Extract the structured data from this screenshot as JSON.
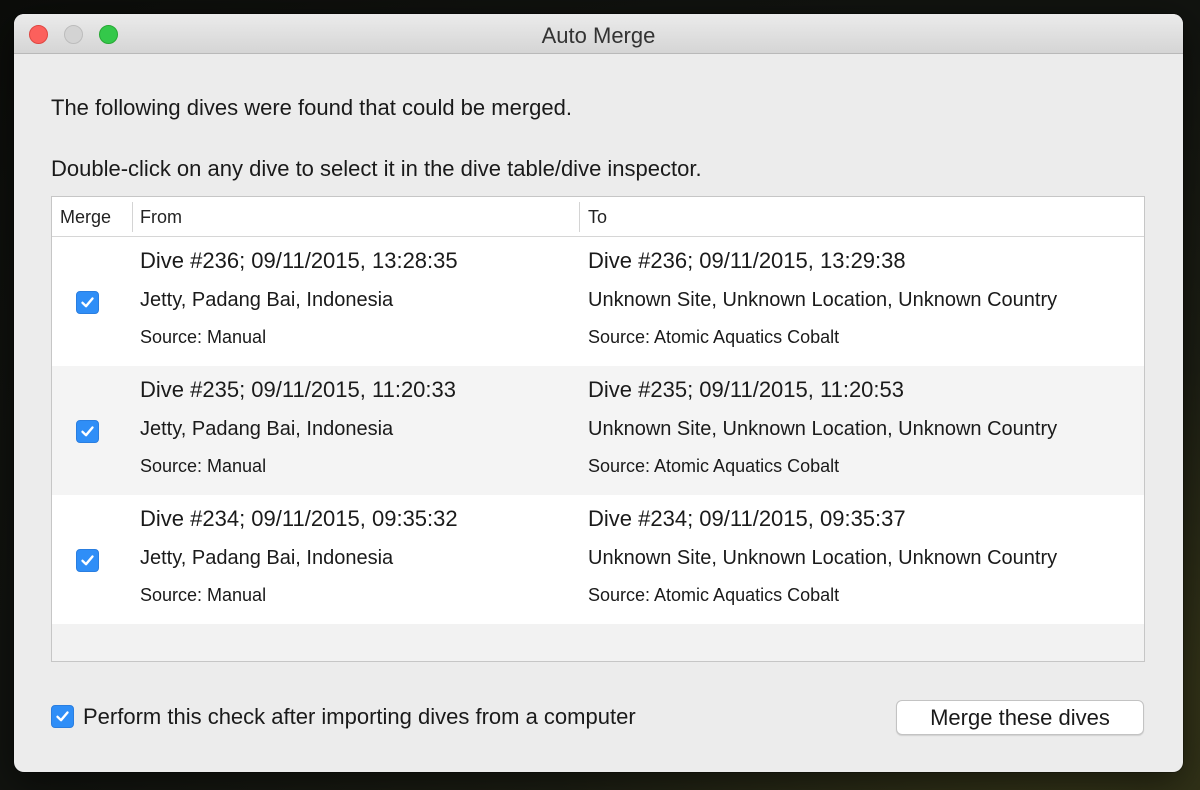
{
  "window": {
    "title": "Auto Merge"
  },
  "intro": {
    "line1": "The following dives were found that could be merged.",
    "line2": "Double-click on any dive to select it in the dive table/dive inspector."
  },
  "table": {
    "headers": {
      "merge": "Merge",
      "from": "From",
      "to": "To"
    },
    "rows": [
      {
        "checked": true,
        "from": {
          "dive": "Dive #236; 09/11/2015, 13:28:35",
          "location": "Jetty, Padang Bai, Indonesia",
          "source": "Source: Manual"
        },
        "to": {
          "dive": "Dive #236; 09/11/2015, 13:29:38",
          "location": "Unknown Site, Unknown Location, Unknown Country",
          "source": "Source: Atomic Aquatics Cobalt"
        }
      },
      {
        "checked": true,
        "from": {
          "dive": "Dive #235; 09/11/2015, 11:20:33",
          "location": "Jetty, Padang Bai, Indonesia",
          "source": "Source: Manual"
        },
        "to": {
          "dive": "Dive #235; 09/11/2015, 11:20:53",
          "location": "Unknown Site, Unknown Location, Unknown Country",
          "source": "Source: Atomic Aquatics Cobalt"
        }
      },
      {
        "checked": true,
        "from": {
          "dive": "Dive #234; 09/11/2015, 09:35:32",
          "location": "Jetty, Padang Bai, Indonesia",
          "source": "Source: Manual"
        },
        "to": {
          "dive": "Dive #234; 09/11/2015, 09:35:37",
          "location": "Unknown Site, Unknown Location, Unknown Country",
          "source": "Source: Atomic Aquatics Cobalt"
        }
      }
    ]
  },
  "footer": {
    "check_label": "Perform this check after importing dives from a computer",
    "check_checked": true,
    "merge_button": "Merge these dives"
  },
  "colors": {
    "accent": "#2f8ef7",
    "close": "#fc605c",
    "maximize": "#34c84a"
  }
}
